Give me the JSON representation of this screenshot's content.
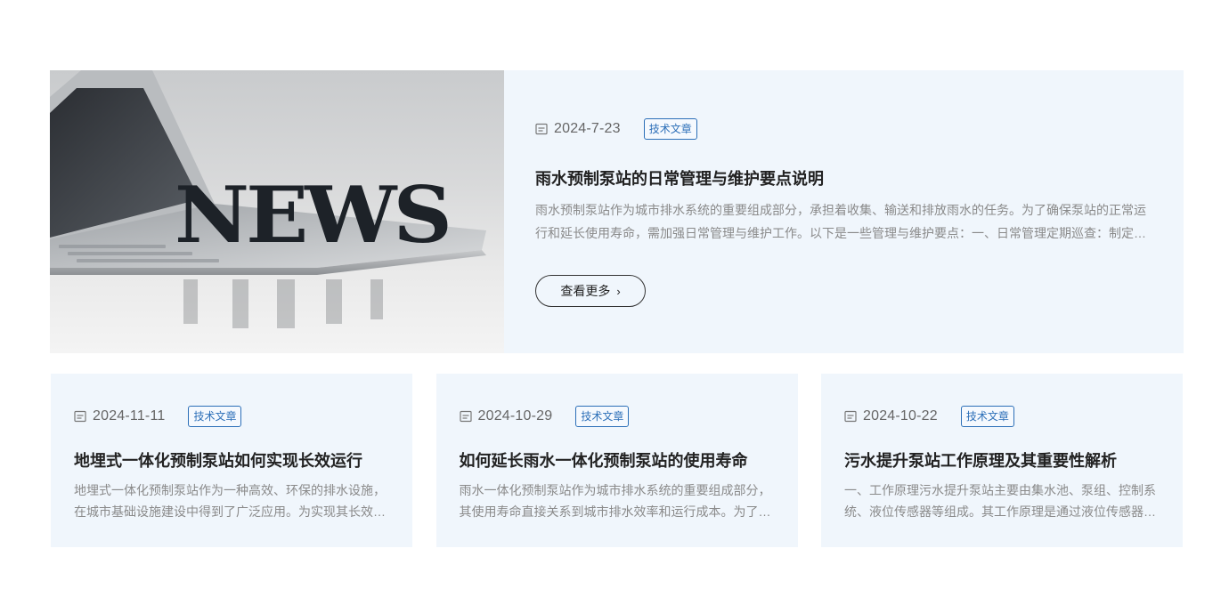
{
  "featured": {
    "image_alt": "NEWS",
    "date": "2024-7-23",
    "tag": "技术文章",
    "title": "雨水预制泵站的日常管理与维护要点说明",
    "description": "雨水预制泵站作为城市排水系统的重要组成部分，承担着收集、输送和排放雨水的任务。为了确保泵站的正常运行和延长使用寿命，需加强日常管理与维护工作。以下是一些管理与维护要点：一、日常管理定期巡查：制定巡查计划，定期对泵站进行巡查。",
    "more_label": "查看更多",
    "icon": "calendar-icon"
  },
  "cards": [
    {
      "date": "2024-11-11",
      "tag": "技术文章",
      "title": "地埋式一体化预制泵站如何实现长效运行",
      "description": "地埋式一体化预制泵站作为一种高效、环保的排水设施，在城市基础设施建设中得到了广泛应用。为实现其长效运行，需要从多方面入手。"
    },
    {
      "date": "2024-10-29",
      "tag": "技术文章",
      "title": "如何延长雨水一体化预制泵站的使用寿命",
      "description": "雨水一体化预制泵站作为城市排水系统的重要组成部分，其使用寿命直接关系到城市排水效率和运行成本。为了延长其使用寿命。"
    },
    {
      "date": "2024-10-22",
      "tag": "技术文章",
      "title": "污水提升泵站工作原理及其重要性解析",
      "description": "一、工作原理污水提升泵站主要由集水池、泵组、控制系统、液位传感器等组成。其工作原理是通过液位传感器监测水位。"
    }
  ],
  "colors": {
    "card_bg": "#f0f6fc",
    "tag_accent": "#2c6fb8",
    "text_muted": "#8a8a8a"
  }
}
